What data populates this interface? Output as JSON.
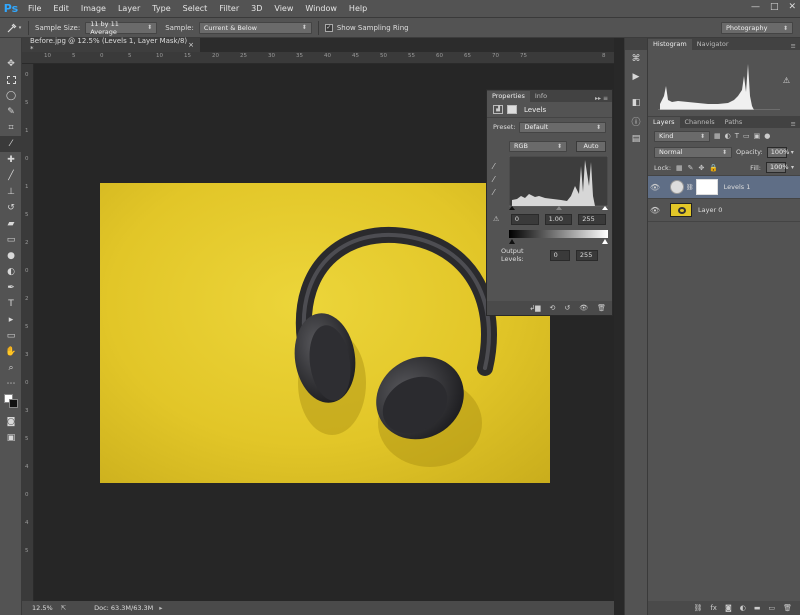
{
  "app": {
    "logo": "Ps",
    "menu": [
      "File",
      "Edit",
      "Image",
      "Layer",
      "Type",
      "Select",
      "Filter",
      "3D",
      "View",
      "Window",
      "Help"
    ],
    "window_controls": [
      "—",
      "□",
      "✕"
    ]
  },
  "options": {
    "tool_icon": "eyedropper-icon",
    "sample_size_label": "Sample Size:",
    "sample_size_value": "11 by 11 Average",
    "sample_label": "Sample:",
    "sample_value": "Current & Below",
    "show_ring_label": "Show Sampling Ring",
    "workspace": "Photography"
  },
  "document": {
    "tab_title": "Before.jpg @ 12.5% (Levels 1, Layer Mask/8) *",
    "tab_close": "×",
    "ruler_h": [
      "10",
      "5",
      "0",
      "5",
      "10",
      "15",
      "20",
      "25",
      "30",
      "35",
      "40",
      "45",
      "50",
      "55",
      "60",
      "65",
      "70",
      "75",
      "8"
    ],
    "ruler_v": [
      "0",
      "5",
      "1",
      "0",
      "1",
      "5",
      "2",
      "0",
      "2",
      "5",
      "3",
      "0",
      "3",
      "5",
      "4",
      "0",
      "4",
      "5"
    ],
    "zoom": "12.5%",
    "doc_info": "Doc: 63.3M/63.3M"
  },
  "properties": {
    "tabs": [
      "Properties",
      "Info"
    ],
    "title": "Levels",
    "preset_label": "Preset:",
    "preset_value": "Default",
    "channel": "RGB",
    "auto_label": "Auto",
    "input_black": "0",
    "input_gamma": "1.00",
    "input_white": "255",
    "output_label": "Output Levels:",
    "output_black": "0",
    "output_white": "255"
  },
  "histogram_panel": {
    "tabs": [
      "Histogram",
      "Navigator"
    ]
  },
  "layers_panel": {
    "tabs": [
      "Layers",
      "Channels",
      "Paths"
    ],
    "kind": "Kind",
    "blend_mode": "Normal",
    "opacity_label": "Opacity:",
    "opacity_value": "100%",
    "lock_label": "Lock:",
    "fill_label": "Fill:",
    "fill_value": "100%",
    "layers": [
      {
        "name": "Levels 1",
        "selected": true
      },
      {
        "name": "Layer 0",
        "selected": false
      }
    ]
  },
  "colors": {
    "chrome": "#535353",
    "workspace": "#282828",
    "accent": "#31a8ff",
    "image_yellow": "#e2c628",
    "selected_layer": "#5f6e86"
  }
}
